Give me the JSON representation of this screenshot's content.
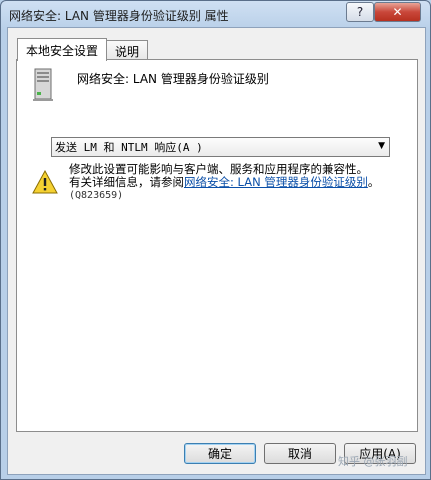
{
  "window": {
    "title": "网络安全: LAN 管理器身份验证级别 属性",
    "help_label": "?",
    "close_label": "✕"
  },
  "tabs": [
    {
      "label": "本地安全设置",
      "active": true
    },
    {
      "label": "说明",
      "active": false
    }
  ],
  "policy": {
    "name": "网络安全: LAN 管理器身份验证级别",
    "icon": "server-icon"
  },
  "dropdown": {
    "selected": "发送 LM 和 NTLM 响应(A )"
  },
  "warning": {
    "icon": "warning-icon",
    "line1": "修改此设置可能影响与客户端、服务和应用程序的兼容性。",
    "line2_prefix": "有关详细信息，请参阅",
    "link": "网络安全: LAN 管理器身份验证级别",
    "line2_suffix": "。",
    "kb": "(Q823659)"
  },
  "buttons": {
    "ok": "确定",
    "cancel": "取消",
    "apply": "应用(A)"
  },
  "watermark": "知乎 @张羽副"
}
